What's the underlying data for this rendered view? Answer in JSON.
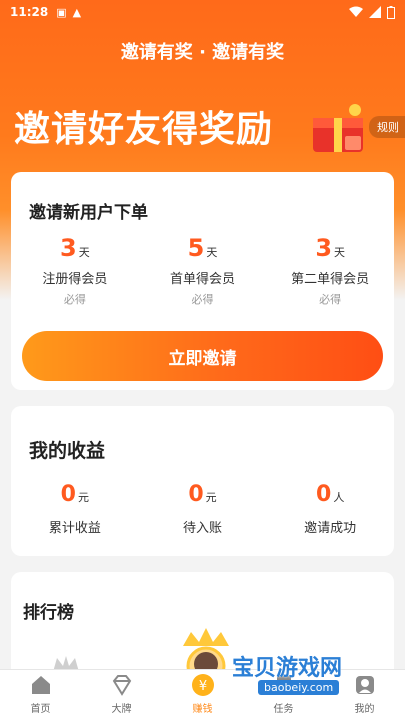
{
  "status_bar": {
    "time": "11:28"
  },
  "header": {
    "title": "邀请有奖 · 邀请有奖"
  },
  "hero": {
    "title": "邀请好友得奖励",
    "rules_label": "规则"
  },
  "invite_card": {
    "title": "邀请新用户下单",
    "items": [
      {
        "value": "3",
        "unit": "天",
        "label": "注册得会员",
        "note": "必得"
      },
      {
        "value": "5",
        "unit": "天",
        "label": "首单得会员",
        "note": "必得"
      },
      {
        "value": "3",
        "unit": "天",
        "label": "第二单得会员",
        "note": "必得"
      }
    ],
    "button_label": "立即邀请"
  },
  "earnings_card": {
    "title": "我的收益",
    "items": [
      {
        "value": "0",
        "unit": "元",
        "label": "累计收益"
      },
      {
        "value": "0",
        "unit": "元",
        "label": "待入账"
      },
      {
        "value": "0",
        "unit": "人",
        "label": "邀请成功"
      }
    ]
  },
  "ranking_card": {
    "title": "排行榜"
  },
  "tabbar": {
    "items": [
      {
        "label": "首页",
        "icon": "home-icon"
      },
      {
        "label": "大牌",
        "icon": "diamond-icon"
      },
      {
        "label": "赚钱",
        "icon": "yen-icon"
      },
      {
        "label": "任务",
        "icon": "task-icon"
      },
      {
        "label": "我的",
        "icon": "user-icon"
      }
    ]
  },
  "watermark": {
    "text": "宝贝游戏网",
    "url": "baobeiy.com"
  },
  "colors": {
    "accent": "#ff5a1f",
    "hero": "#ff6a1a",
    "tab_active": "#ff8a1a"
  }
}
